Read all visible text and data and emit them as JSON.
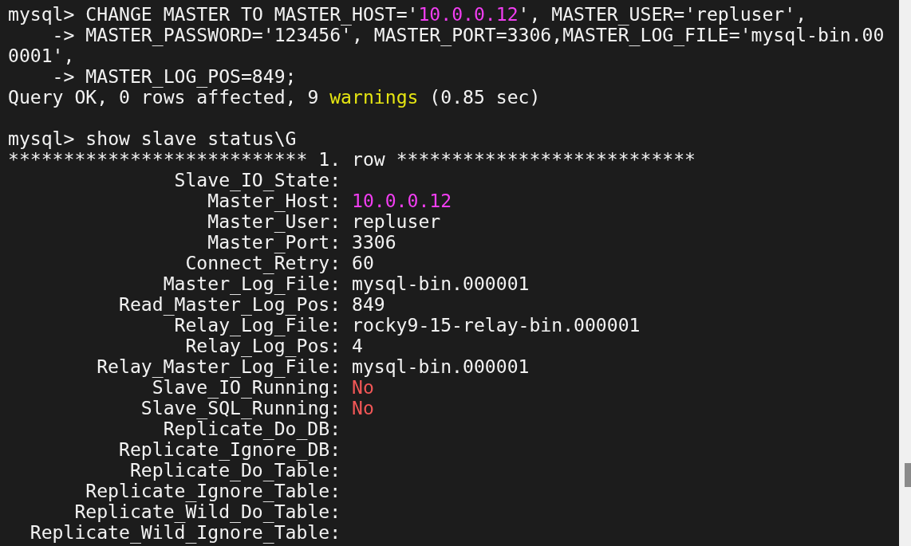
{
  "terminal": {
    "lines": [
      {
        "kind": "text",
        "segments": [
          {
            "text": "mysql> CHANGE MASTER TO MASTER_HOST='",
            "color": "#f2f2f2"
          },
          {
            "text": "10.0.0.12",
            "color": "#f13ef1"
          },
          {
            "text": "', MASTER_USER='repluser',",
            "color": "#f2f2f2"
          }
        ]
      },
      {
        "kind": "continuation",
        "segments": [
          {
            "text": "-> MASTER_PASSWORD='123456', MASTER_PORT=3306,MASTER_LOG_FILE='mysql-bin.00",
            "color": "#f2f2f2"
          }
        ]
      },
      {
        "kind": "text",
        "segments": [
          {
            "text": "0001',",
            "color": "#f2f2f2"
          }
        ]
      },
      {
        "kind": "continuation",
        "segments": [
          {
            "text": "-> MASTER_LOG_POS=849;",
            "color": "#f2f2f2"
          }
        ]
      },
      {
        "kind": "text",
        "segments": [
          {
            "text": "Query OK, 0 rows affected, 9 ",
            "color": "#f2f2f2"
          },
          {
            "text": "warnings",
            "color": "#e5e512"
          },
          {
            "text": " (0.85 sec)",
            "color": "#f2f2f2"
          }
        ]
      },
      {
        "kind": "blank"
      },
      {
        "kind": "text",
        "segments": [
          {
            "text": "mysql> show slave status\\G",
            "color": "#f2f2f2"
          }
        ]
      },
      {
        "kind": "text",
        "segments": [
          {
            "text": "*************************** 1. row ***************************",
            "color": "#f2f2f2"
          }
        ]
      },
      {
        "kind": "field",
        "label": "Slave_IO_State:"
      },
      {
        "kind": "field",
        "label": "Master_Host:",
        "value": "10.0.0.12",
        "color": "#f13ef1"
      },
      {
        "kind": "field",
        "label": "Master_User:",
        "value": "repluser",
        "color": "#f2f2f2"
      },
      {
        "kind": "field",
        "label": "Master_Port:",
        "value": "3306",
        "color": "#f2f2f2"
      },
      {
        "kind": "field",
        "label": "Connect_Retry:",
        "value": "60",
        "color": "#f2f2f2"
      },
      {
        "kind": "field",
        "label": "Master_Log_File:",
        "value": "mysql-bin.000001",
        "color": "#f2f2f2"
      },
      {
        "kind": "field",
        "label": "Read_Master_Log_Pos:",
        "value": "849",
        "color": "#f2f2f2"
      },
      {
        "kind": "field",
        "label": "Relay_Log_File:",
        "value": "rocky9-15-relay-bin.000001",
        "color": "#f2f2f2"
      },
      {
        "kind": "field",
        "label": "Relay_Log_Pos:",
        "value": "4",
        "color": "#f2f2f2"
      },
      {
        "kind": "field",
        "label": "Relay_Master_Log_File:",
        "value": "mysql-bin.000001",
        "color": "#f2f2f2"
      },
      {
        "kind": "field",
        "label": "Slave_IO_Running:",
        "value": "No",
        "color": "#f25757"
      },
      {
        "kind": "field",
        "label": "Slave_SQL_Running:",
        "value": "No",
        "color": "#f25757"
      },
      {
        "kind": "field",
        "label": "Replicate_Do_DB:"
      },
      {
        "kind": "field",
        "label": "Replicate_Ignore_DB:"
      },
      {
        "kind": "field",
        "label": "Replicate_Do_Table:"
      },
      {
        "kind": "field",
        "label": "Replicate_Ignore_Table:"
      },
      {
        "kind": "field",
        "label": "Replicate_Wild_Do_Table:"
      },
      {
        "kind": "field",
        "label": "Replicate_Wild_Ignore_Table:"
      }
    ]
  }
}
